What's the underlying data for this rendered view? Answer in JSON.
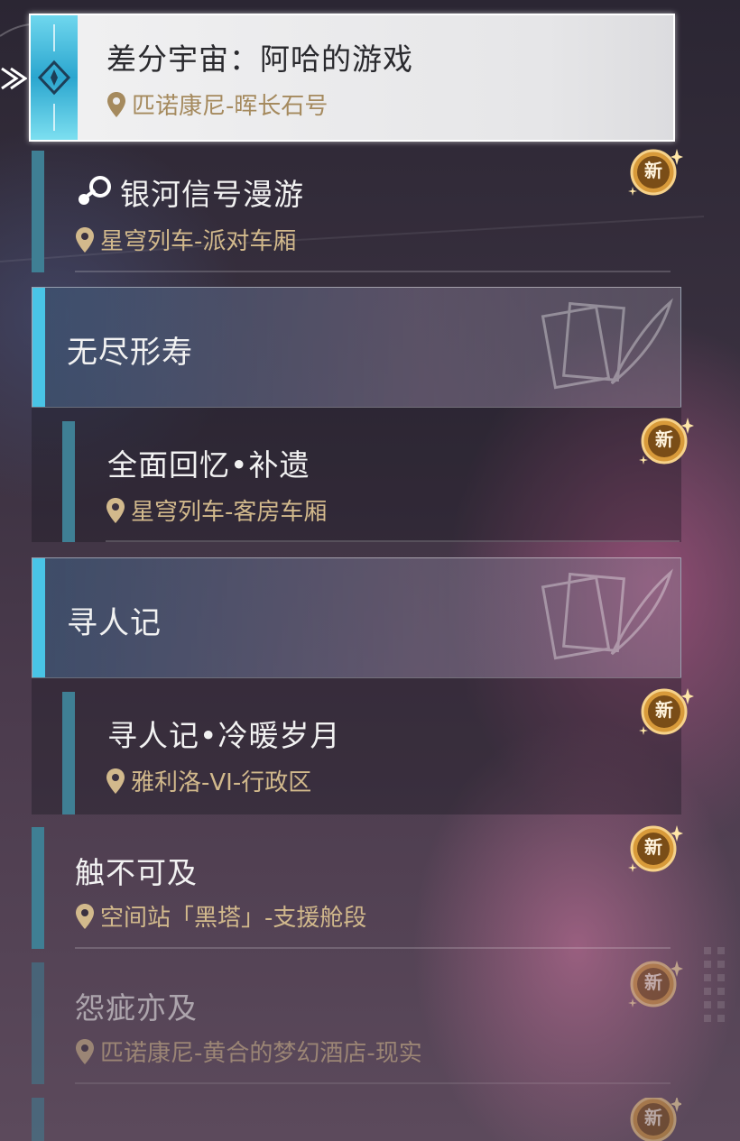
{
  "selected": {
    "title": "差分宇宙：阿哈的游戏",
    "location": "匹诺康尼-晖长石号"
  },
  "entries": [
    {
      "title": "银河信号漫游",
      "location": "星穹列车-派对车厢",
      "badge": "新",
      "icon": "galaxy-signal-icon"
    },
    {
      "title": "全面回忆•补遗",
      "location": "星穹列车-客房车厢",
      "badge": "新"
    },
    {
      "title": "寻人记•冷暖岁月",
      "location": "雅利洛-VI-行政区",
      "badge": "新"
    },
    {
      "title": "触不可及",
      "location": "空间站「黑塔」-支援舱段",
      "badge": "新"
    },
    {
      "title": "怨疵亦及",
      "location": "匹诺康尼-黄合的梦幻酒店-现实",
      "badge": "新"
    },
    {
      "title": "",
      "location": "",
      "badge": "新"
    }
  ],
  "categories": [
    {
      "title": "无尽形寿"
    },
    {
      "title": "寻人记"
    }
  ],
  "colors": {
    "accent": "#49c4e6",
    "entry_bar": "#3f7f94",
    "location_text": "#d2b98c",
    "badge": "#d89a3a"
  }
}
